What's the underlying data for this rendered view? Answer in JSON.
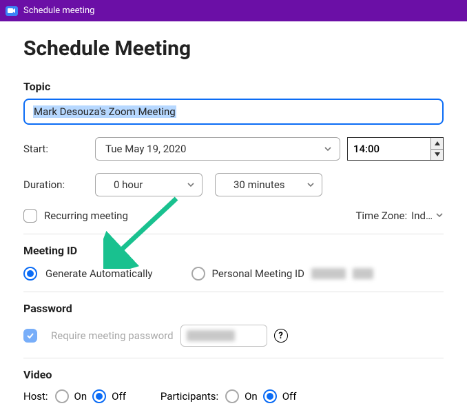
{
  "titlebar": {
    "title": "Schedule meeting"
  },
  "page": {
    "title": "Schedule Meeting"
  },
  "topic": {
    "label": "Topic",
    "value": "Mark Desouza's Zoom Meeting"
  },
  "start": {
    "label": "Start:",
    "date": "Tue  May 19, 2020",
    "time": "14:00"
  },
  "duration": {
    "label": "Duration:",
    "hours": "0 hour",
    "minutes": "30 minutes"
  },
  "recurring": {
    "label": "Recurring meeting"
  },
  "timezone": {
    "label": "Time Zone:",
    "value": "Ind…"
  },
  "meeting_id": {
    "label": "Meeting ID",
    "auto_label": "Generate Automatically",
    "personal_label": "Personal Meeting ID"
  },
  "password": {
    "label": "Password",
    "require_label": "Require meeting password"
  },
  "video": {
    "label": "Video",
    "host_label": "Host:",
    "participants_label": "Participants:",
    "on": "On",
    "off": "Off"
  }
}
